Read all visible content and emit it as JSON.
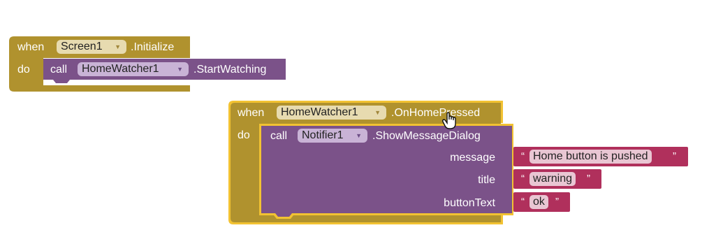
{
  "colors": {
    "event_block": "#b0922e",
    "method_block": "#7b5289",
    "text_block": "#b0305c",
    "selection_outline": "#f2c232"
  },
  "block1": {
    "when": "when",
    "component": "Screen1",
    "event": ".Initialize",
    "do": "do",
    "call": {
      "call": "call",
      "component": "HomeWatcher1",
      "method": ".StartWatching"
    }
  },
  "block2": {
    "when": "when",
    "component": "HomeWatcher1",
    "event": ".OnHomePressed",
    "do": "do",
    "call": {
      "call": "call",
      "component": "Notifier1",
      "method": ".ShowMessageDialog",
      "args": [
        {
          "label": "message",
          "value": "Home button is pushed"
        },
        {
          "label": "title",
          "value": "warning"
        },
        {
          "label": "buttonText",
          "value": "ok"
        }
      ]
    }
  },
  "quotes": {
    "open": "“",
    "close": "”"
  },
  "cursor": "hand-pointer-icon"
}
